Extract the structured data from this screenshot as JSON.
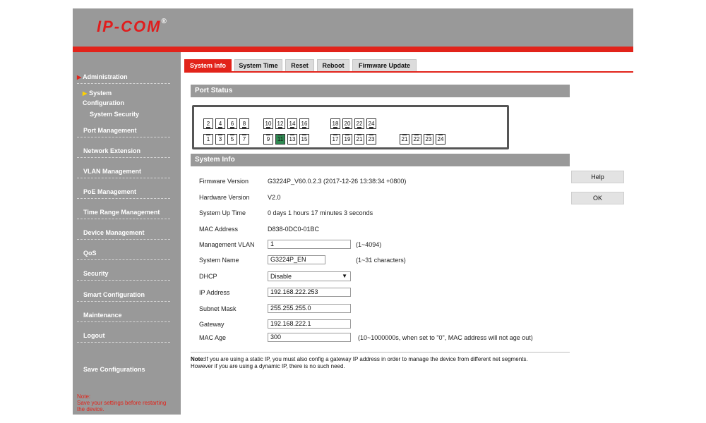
{
  "brand": {
    "logo_text": "IP-COM",
    "logo_mark": "®"
  },
  "sidebar": {
    "items": [
      {
        "id": "administration",
        "label": "Administration",
        "active": true
      },
      {
        "id": "port-management",
        "label": "Port Management"
      },
      {
        "id": "network-extension",
        "label": "Network Extension"
      },
      {
        "id": "vlan-management",
        "label": "VLAN Management"
      },
      {
        "id": "poe-management",
        "label": "PoE Management"
      },
      {
        "id": "time-range-management",
        "label": "Time Range Management"
      },
      {
        "id": "device-management",
        "label": "Device Management"
      },
      {
        "id": "qos",
        "label": "QoS"
      },
      {
        "id": "security",
        "label": "Security"
      },
      {
        "id": "smart-configuration",
        "label": "Smart Configuration"
      },
      {
        "id": "maintenance",
        "label": "Maintenance"
      },
      {
        "id": "logout",
        "label": "Logout"
      },
      {
        "id": "save-configurations",
        "label": "Save Configurations"
      }
    ],
    "subitems": [
      {
        "id": "system-configuration",
        "label_line1": "System",
        "label_line2": "Configuration",
        "active": true
      },
      {
        "id": "system-security",
        "label": "System Security"
      }
    ],
    "note_title": "Note:",
    "note_text": "Save your settings before restarting the device."
  },
  "tabs": [
    {
      "id": "system-info",
      "label": "System Info",
      "active": true
    },
    {
      "id": "system-time",
      "label": "System Time"
    },
    {
      "id": "reset",
      "label": "Reset"
    },
    {
      "id": "reboot",
      "label": "Reboot"
    },
    {
      "id": "firmware-update",
      "label": "Firmware Update"
    }
  ],
  "port_status": {
    "title": "Port Status",
    "top_row": [
      "2",
      "4",
      "6",
      "8",
      "10",
      "12",
      "14",
      "16",
      "18",
      "20",
      "22",
      "24"
    ],
    "bottom_row": [
      "1",
      "3",
      "5",
      "7",
      "9",
      "11",
      "13",
      "15",
      "17",
      "19",
      "21",
      "23"
    ],
    "sfp_row": [
      "21",
      "22",
      "23",
      "24"
    ],
    "active_port": "11"
  },
  "system_info": {
    "title": "System Info",
    "firmware_label": "Firmware Version",
    "firmware_value": "G3224P_V60.0.2.3 (2017-12-26 13:38:34 +0800)",
    "hardware_label": "Hardware Version",
    "hardware_value": "V2.0",
    "uptime_label": "System Up Time",
    "uptime_value": "0 days 1 hours 17 minutes 3 seconds",
    "mac_label": "MAC Address",
    "mac_value": "D838-0DC0-01BC",
    "mgmt_vlan_label": "Management VLAN",
    "mgmt_vlan_value": "1",
    "mgmt_vlan_hint": "(1~4094)",
    "system_name_label": "System Name",
    "system_name_value": "G3224P_EN",
    "system_name_hint": "(1~31 characters)",
    "dhcp_label": "DHCP",
    "dhcp_value": "Disable",
    "ip_label": "IP Address",
    "ip_value": "192.168.222.253",
    "mask_label": "Subnet Mask",
    "mask_value": "255.255.255.0",
    "gateway_label": "Gateway",
    "gateway_value": "192.168.222.1",
    "mac_age_label": "MAC Age",
    "mac_age_value": "300",
    "mac_age_hint": "(10~1000000s, when set to \"0\", MAC address will not age out)"
  },
  "note": {
    "prefix": "Note:",
    "text": "If you are using a static IP, you must also config a gateway IP address in order to manage the device from different net segments.",
    "line2": "However if you are using a dynamic IP, there is no such need."
  },
  "buttons": {
    "help": "Help",
    "ok": "OK"
  }
}
